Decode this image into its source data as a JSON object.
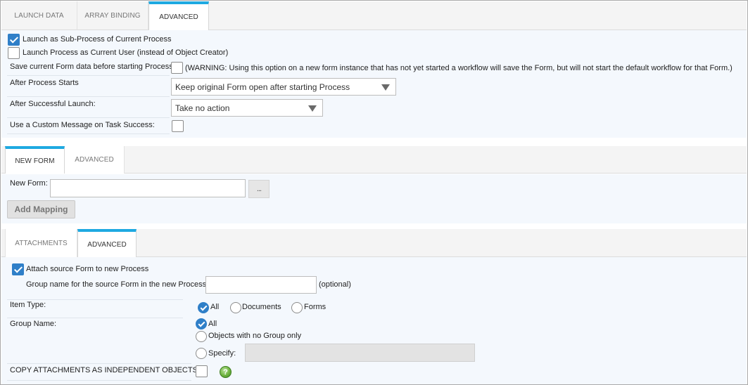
{
  "top_tabs": [
    {
      "label": "LAUNCH DATA",
      "active": false
    },
    {
      "label": "ARRAY BINDING",
      "active": false
    },
    {
      "label": "ADVANCED",
      "active": true
    }
  ],
  "launch_advanced": {
    "sub_process_label": "Launch as Sub-Process of Current Process",
    "sub_process_checked": true,
    "current_user_label": "Launch Process as Current User (instead of Object Creator)",
    "current_user_checked": false,
    "save_form_label": "Save current Form data before starting Process",
    "save_form_checked": false,
    "save_form_warning": "(WARNING: Using this option on a new form instance that has not yet started a workflow will save the Form, but will not start the default workflow for that Form.)",
    "after_process_label": "After Process Starts",
    "after_process_value": "Keep original Form open after starting Process",
    "after_launch_label": "After Successful Launch:",
    "after_launch_value": "Take no action",
    "custom_message_label": "Use a Custom Message on Task Success:",
    "custom_message_checked": false
  },
  "form_tabs": [
    {
      "label": "NEW FORM",
      "active": true
    },
    {
      "label": "ADVANCED",
      "active": false
    }
  ],
  "new_form": {
    "label": "New Form:",
    "value": "",
    "browse_label": "...",
    "add_mapping_label": "Add Mapping"
  },
  "attach_tabs": [
    {
      "label": "ATTACHMENTS",
      "active": false
    },
    {
      "label": "ADVANCED",
      "active": true
    }
  ],
  "attachments_advanced": {
    "attach_source_label": "Attach source Form to new Process",
    "attach_source_checked": true,
    "group_name_source_label": "Group name for the source Form in the new Process:",
    "group_name_source_value": "",
    "optional_label": "(optional)",
    "item_type_label": "Item Type:",
    "item_type_options": [
      "All",
      "Documents",
      "Forms"
    ],
    "item_type_selected": "All",
    "group_name_label": "Group Name:",
    "group_name_options": [
      "All",
      "Objects with no Group only",
      "Specify:"
    ],
    "group_name_selected": "All",
    "specify_value": "",
    "copy_attachments_label": "COPY ATTACHMENTS AS INDEPENDENT OBJECTS",
    "copy_attachments_checked": false,
    "help_glyph": "?"
  },
  "colors": {
    "accent": "#1ea9e1",
    "checkbox_blue": "#2f7fc8",
    "panel_bg": "#f4f8fd",
    "tabbar_bg": "#f4f4f4",
    "help_green": "#6fb33f"
  }
}
